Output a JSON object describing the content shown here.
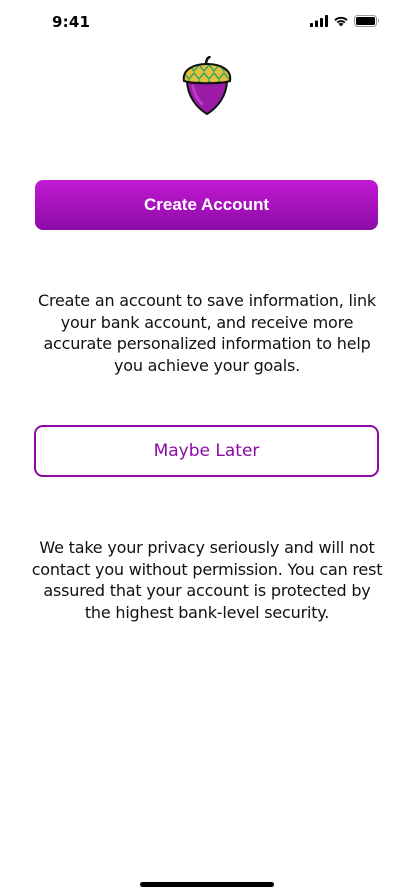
{
  "status_bar": {
    "time": "9:41",
    "icons": [
      "cellular-signal-icon",
      "wifi-icon",
      "battery-icon"
    ]
  },
  "logo": {
    "icon": "acorn-logo-icon",
    "colors": {
      "cap_green": "#1ea36a",
      "cap_gold": "#e4c03a",
      "body_purple": "#9b1aa6",
      "outline": "#111111"
    }
  },
  "primary_action": {
    "label": "Create Account",
    "color_top": "#c21ad3",
    "color_bottom": "#8d0aa6"
  },
  "description": "Create an account to save information, link your bank account, and receive more accurate personalized information to help you achieve your goals.",
  "secondary_action": {
    "label": "Maybe Later",
    "color": "#8e0aa5"
  },
  "privacy_note": "We take your privacy seriously and will not contact you without permission. You can rest assured that your account is protected by the highest bank-level security."
}
